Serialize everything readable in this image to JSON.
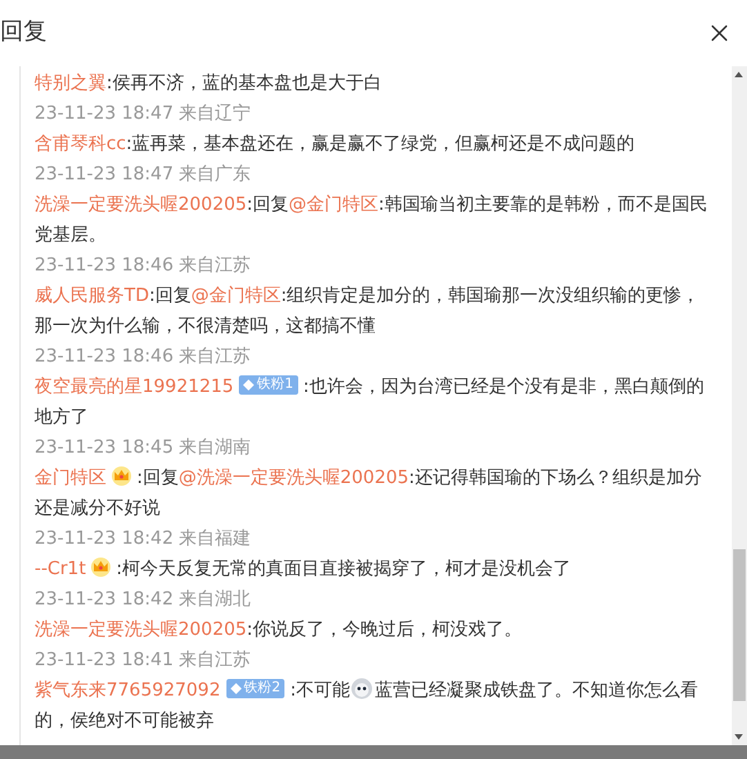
{
  "header": {
    "title": "回复"
  },
  "separator": ":",
  "comments": [
    {
      "user": "特别之翼",
      "segments": [
        {
          "kind": "text",
          "text": "侯再不济，蓝的基本盘也是大于白"
        }
      ],
      "time": "23-11-23 18:47 来自辽宁"
    },
    {
      "user": "含甫琴科cc",
      "segments": [
        {
          "kind": "text",
          "text": "蓝再菜，基本盘还在，赢是赢不了绿党，但赢柯还是不成问题的"
        }
      ],
      "time": "23-11-23 18:47 来自广东"
    },
    {
      "user": "洗澡一定要洗头喔200205",
      "reply_label": "回复",
      "reply_to": "@金门特区",
      "segments": [
        {
          "kind": "text",
          "text": "韩国瑜当初主要靠的是韩粉，而不是国民党基层。"
        }
      ],
      "time": "23-11-23 18:46 来自江苏"
    },
    {
      "user": "威人民服务TD",
      "reply_label": "回复",
      "reply_to": "@金门特区",
      "segments": [
        {
          "kind": "text",
          "text": "组织肯定是加分的，韩国瑜那一次没组织输的更惨，那一次为什么输，不很清楚吗，这都搞不懂"
        }
      ],
      "time": "23-11-23 18:46 来自江苏"
    },
    {
      "user": "夜空最亮的星19921215",
      "badge": {
        "kind": "fan",
        "label": "铁粉1"
      },
      "segments": [
        {
          "kind": "text",
          "text": "也许会，因为台湾已经是个没有是非，黑白颠倒的地方了"
        }
      ],
      "time": "23-11-23 18:45 来自湖南"
    },
    {
      "user": "金门特区",
      "badge": {
        "kind": "crown"
      },
      "reply_label": "回复",
      "reply_to": "@洗澡一定要洗头喔200205",
      "segments": [
        {
          "kind": "text",
          "text": "还记得韩国瑜的下场么？组织是加分还是减分不好说"
        }
      ],
      "time": "23-11-23 18:42 来自福建"
    },
    {
      "user": "--Cr1t",
      "badge": {
        "kind": "crown"
      },
      "segments": [
        {
          "kind": "text",
          "text": "柯今天反复无常的真面目直接被揭穿了，柯才是没机会了"
        }
      ],
      "time": "23-11-23 18:42 来自湖北"
    },
    {
      "user": "洗澡一定要洗头喔200205",
      "segments": [
        {
          "kind": "text",
          "text": "你说反了，今晚过后，柯没戏了。"
        }
      ],
      "time": "23-11-23 18:41 来自江苏"
    },
    {
      "user": "紫气东来7765927092",
      "badge": {
        "kind": "fan",
        "label": "铁粉2"
      },
      "segments": [
        {
          "kind": "text",
          "text": "不可能"
        },
        {
          "kind": "emoji"
        },
        {
          "kind": "text",
          "text": "蓝营已经凝聚成铁盘了。不知道你怎么看的，侯绝对不可能被弃"
        }
      ]
    }
  ]
}
